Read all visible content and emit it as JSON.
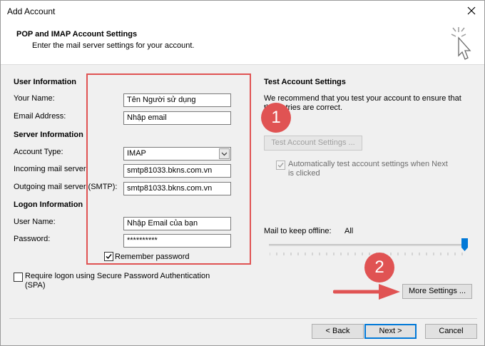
{
  "window": {
    "title": "Add Account"
  },
  "header": {
    "title": "POP and IMAP Account Settings",
    "subtitle": "Enter the mail server settings for your account."
  },
  "user_info": {
    "section": "User Information",
    "name_label": "Your Name:",
    "name_value": "Tên Người sử dụng",
    "email_label": "Email Address:",
    "email_value": "Nhập email"
  },
  "server_info": {
    "section": "Server Information",
    "account_type_label": "Account Type:",
    "account_type_value": "IMAP",
    "incoming_label": "Incoming mail server:",
    "incoming_value": "smtp81033.bkns.com.vn",
    "outgoing_label": "Outgoing mail server (SMTP):",
    "outgoing_value": "smtp81033.bkns.com.vn"
  },
  "logon_info": {
    "section": "Logon Information",
    "user_label": "User Name:",
    "user_value": "Nhập Email của bạn",
    "password_label": "Password:",
    "password_value": "**********",
    "remember_label": "Remember password",
    "remember_checked": true,
    "spa_label_line1": "Require logon using Secure Password Authentication",
    "spa_label_line2": "(SPA)",
    "spa_checked": false
  },
  "test_settings": {
    "section": "Test Account Settings",
    "desc_line1": "We recommend that you test your account to ensure that",
    "desc_line2": "the entries are correct.",
    "test_button": "Test Account Settings ...",
    "auto_test_line1": "Automatically test account settings when Next",
    "auto_test_line2": "is clicked",
    "auto_test_checked": true
  },
  "offline": {
    "label": "Mail to keep offline:",
    "value": "All",
    "level": 1.0
  },
  "more_settings_button": "More Settings ...",
  "footer": {
    "back": "< Back",
    "next": "Next >",
    "cancel": "Cancel"
  },
  "annotations": {
    "badge1": "1",
    "badge2": "2",
    "highlight_color": "#e05353"
  }
}
